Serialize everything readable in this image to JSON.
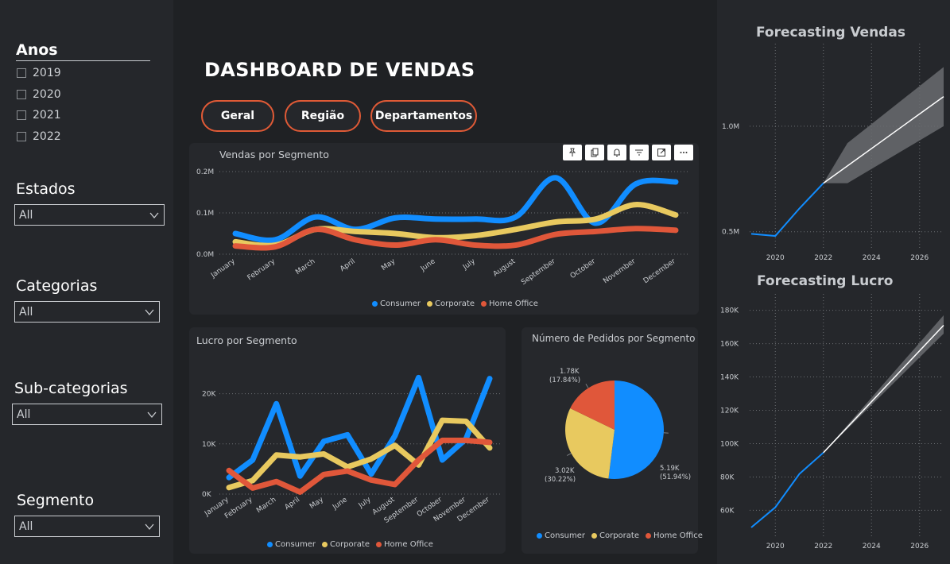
{
  "sidebar": {
    "anos_title": "Anos",
    "years": [
      "2019",
      "2020",
      "2021",
      "2022"
    ],
    "estados_title": "Estados",
    "estados_value": "All",
    "categorias_title": "Categorias",
    "categorias_value": "All",
    "subcategorias_title": "Sub-categorias",
    "subcategorias_value": "All",
    "segmento_title": "Segmento",
    "segmento_value": "All"
  },
  "header": {
    "title": "DASHBOARD DE VENDAS",
    "buttons": [
      "Geral",
      "Região",
      "Departamentos"
    ]
  },
  "colors": {
    "consumer": "#118dff",
    "corporate": "#e8c95f",
    "home_office": "#e0573a",
    "accent": "#e05a36",
    "forecast": "#ffffff"
  },
  "chart_data": [
    {
      "type": "line",
      "title": "Vendas por Segmento",
      "categories": [
        "January",
        "February",
        "March",
        "April",
        "May",
        "June",
        "July",
        "August",
        "September",
        "October",
        "November",
        "December"
      ],
      "ytick_labels": [
        "0.0M",
        "0.1M",
        "0.2M"
      ],
      "ylim": [
        0,
        0.2
      ],
      "series": [
        {
          "name": "Consumer",
          "values": [
            0.05,
            0.035,
            0.09,
            0.06,
            0.088,
            0.085,
            0.085,
            0.09,
            0.185,
            0.075,
            0.17,
            0.175
          ]
        },
        {
          "name": "Corporate",
          "values": [
            0.03,
            0.022,
            0.06,
            0.055,
            0.05,
            0.04,
            0.045,
            0.06,
            0.078,
            0.085,
            0.12,
            0.095
          ]
        },
        {
          "name": "Home Office",
          "values": [
            0.02,
            0.018,
            0.06,
            0.035,
            0.022,
            0.035,
            0.022,
            0.022,
            0.048,
            0.055,
            0.062,
            0.058
          ]
        }
      ],
      "legend": [
        "Consumer",
        "Corporate",
        "Home Office"
      ],
      "legend_position": "bottom"
    },
    {
      "type": "line",
      "title": "Lucro por Segmento",
      "categories": [
        "January",
        "February",
        "March",
        "April",
        "May",
        "June",
        "July",
        "August",
        "September",
        "October",
        "November",
        "December"
      ],
      "ytick_labels": [
        "0K",
        "10K",
        "20K"
      ],
      "ylim": [
        0,
        25000
      ],
      "series": [
        {
          "name": "Consumer",
          "values": [
            3300,
            6800,
            18000,
            3600,
            10500,
            11800,
            4000,
            11600,
            23200,
            6800,
            11000,
            23000
          ]
        },
        {
          "name": "Corporate",
          "values": [
            1300,
            2700,
            7800,
            7400,
            8000,
            5400,
            7000,
            9700,
            5800,
            14700,
            14500,
            9200
          ]
        },
        {
          "name": "Home Office",
          "values": [
            4700,
            1200,
            2500,
            400,
            3900,
            4600,
            2800,
            1900,
            6800,
            10700,
            10700,
            10300
          ]
        }
      ],
      "legend": [
        "Consumer",
        "Corporate",
        "Home Office"
      ],
      "legend_position": "bottom"
    },
    {
      "type": "pie",
      "title": "Número de Pedidos por Segmento",
      "slices": [
        {
          "name": "Consumer",
          "value": 5190,
          "label": "5.19K",
          "pct": "(51.94%)"
        },
        {
          "name": "Corporate",
          "value": 3020,
          "label": "3.02K",
          "pct": "(30.22%)"
        },
        {
          "name": "Home Office",
          "value": 1780,
          "label": "1.78K",
          "pct": "(17.84%)"
        }
      ],
      "legend": [
        "Consumer",
        "Corporate",
        "Home Office"
      ],
      "legend_position": "bottom"
    },
    {
      "type": "line",
      "title": "Forecasting Vendas",
      "xticks": [
        "2020",
        "2022",
        "2024",
        "2026"
      ],
      "ytick_labels": [
        "0.5M",
        "1.0M"
      ],
      "ylim": [
        0.42,
        1.18
      ],
      "xlim": [
        2019,
        2027
      ],
      "actual": {
        "x": [
          2019,
          2020,
          2021,
          2022
        ],
        "y": [
          0.49,
          0.48,
          0.61,
          0.73
        ]
      },
      "forecast": {
        "x": [
          2022,
          2027
        ],
        "y": [
          0.73,
          1.14
        ]
      },
      "band": {
        "x": [
          2022,
          2023,
          2027
        ],
        "upper": [
          0.73,
          0.92,
          1.28
        ],
        "lower": [
          0.73,
          0.73,
          1.0
        ]
      }
    },
    {
      "type": "line",
      "title": "Forecasting Lucro",
      "xticks": [
        "2020",
        "2022",
        "2024",
        "2026"
      ],
      "ytick_labels": [
        "60K",
        "80K",
        "100K",
        "120K",
        "140K",
        "160K",
        "180K"
      ],
      "ylim": [
        44000,
        186000
      ],
      "xlim": [
        2019,
        2027
      ],
      "actual": {
        "x": [
          2019,
          2020,
          2021,
          2022
        ],
        "y": [
          49700,
          61800,
          81800,
          94600
        ]
      },
      "forecast": {
        "x": [
          2022,
          2027
        ],
        "y": [
          94600,
          171000
        ]
      },
      "band": {
        "x": [
          2022,
          2027
        ],
        "upper": [
          94600,
          177000
        ],
        "lower": [
          94600,
          166000
        ]
      }
    }
  ]
}
